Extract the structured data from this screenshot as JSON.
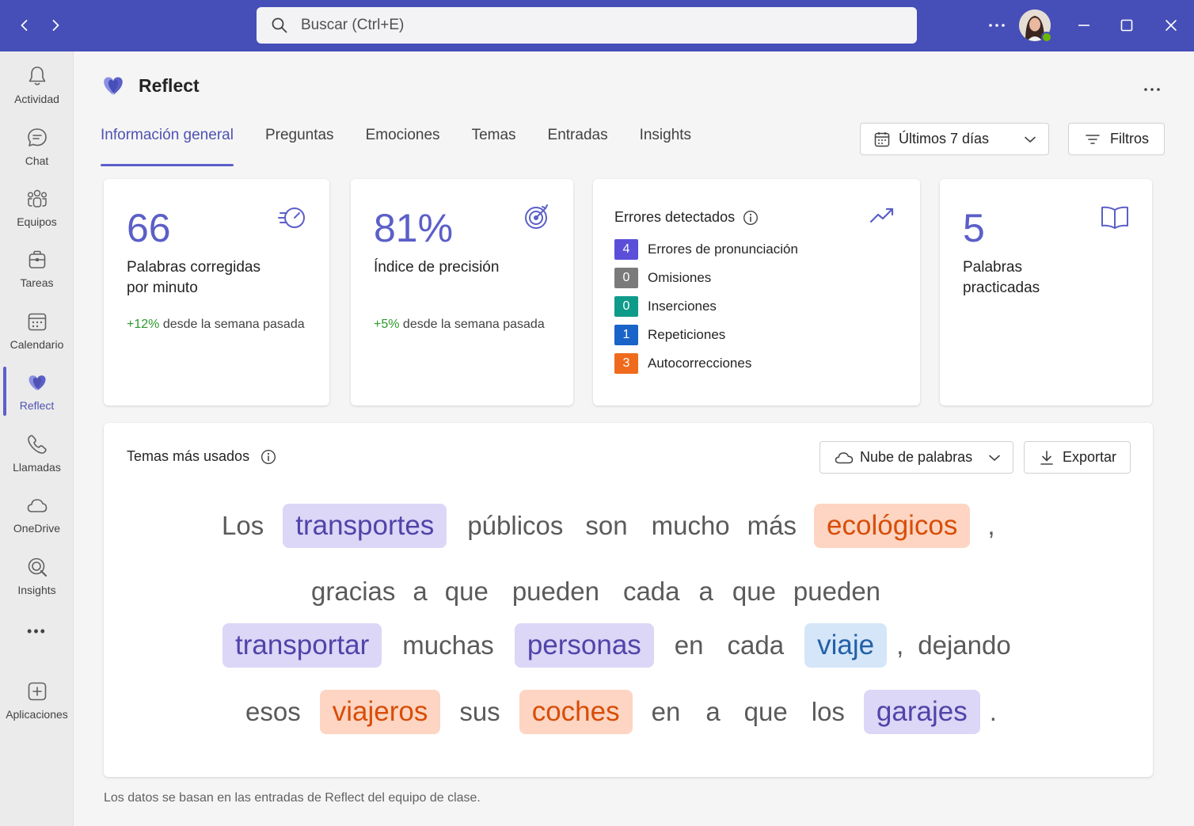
{
  "colors": {
    "titlebar": "#464eb8",
    "accent": "#5b5fc7",
    "positive": "#2c9a2c",
    "chip_purple": "#dcd6f7",
    "chip_orange": "#fdd5c2",
    "chip_blue": "#d4e6f8"
  },
  "titlebar": {
    "search_placeholder": "Buscar (Ctrl+E)",
    "icons": [
      "back-icon",
      "forward-icon",
      "more-icon",
      "avatar",
      "minimize-icon",
      "maximize-icon",
      "close-icon"
    ]
  },
  "rail": {
    "items": [
      {
        "label": "Actividad",
        "icon": "bell-icon"
      },
      {
        "label": "Chat",
        "icon": "chat-icon"
      },
      {
        "label": "Equipos",
        "icon": "teams-icon"
      },
      {
        "label": "Tareas",
        "icon": "tasks-icon"
      },
      {
        "label": "Calendario",
        "icon": "calendar-icon"
      },
      {
        "label": "Reflect",
        "icon": "reflect-icon",
        "active": true
      },
      {
        "label": "Llamadas",
        "icon": "phone-icon"
      },
      {
        "label": "OneDrive",
        "icon": "cloud-icon"
      },
      {
        "label": "Insights",
        "icon": "insights-icon"
      },
      {
        "label": "Aplicaciones",
        "icon": "add-app-icon"
      }
    ],
    "more_label": "•••"
  },
  "app": {
    "title": "Reflect"
  },
  "tabs": [
    {
      "label": "Información general",
      "active": true
    },
    {
      "label": "Preguntas"
    },
    {
      "label": "Emociones"
    },
    {
      "label": "Temas"
    },
    {
      "label": "Entradas"
    },
    {
      "label": "Insights"
    }
  ],
  "toolbar": {
    "date_range": "Últimos 7 días",
    "filters_label": "Filtros"
  },
  "cards": {
    "wcpm": {
      "value": "66",
      "label_line1": "Palabras corregidas",
      "label_line2": "por minuto",
      "delta": "+12%",
      "delta_text": " desde la semana pasada",
      "icon": "speed-icon"
    },
    "accuracy": {
      "value": "81%",
      "label": "Índice de precisión",
      "delta": "+5%",
      "delta_text": " desde la semana pasada",
      "icon": "target-icon"
    },
    "errors": {
      "title": "Errores detectados",
      "icon": "trend-up-icon",
      "rows": [
        {
          "count": "4",
          "label": "Errores de pronunciación",
          "color": "#5b4fd9"
        },
        {
          "count": "0",
          "label": "Omisiones",
          "color": "#7a7a7a"
        },
        {
          "count": "0",
          "label": "Inserciones",
          "color": "#0e9b8a"
        },
        {
          "count": "1",
          "label": "Repeticiones",
          "color": "#1a63c9"
        },
        {
          "count": "3",
          "label": "Autocorrecciones",
          "color": "#f06a1d"
        }
      ]
    },
    "words": {
      "value": "5",
      "label_line1": "Palabras",
      "label_line2": "practicadas",
      "icon": "book-icon"
    }
  },
  "topics": {
    "title": "Temas más usados",
    "view_label": "Nube de palabras",
    "export_label": "Exportar",
    "lines": [
      [
        {
          "t": "Los"
        },
        {
          "t": "transportes",
          "c": "purple"
        },
        {
          "t": "públicos"
        },
        {
          "t": "son"
        },
        {
          "t": "mucho"
        },
        {
          "t": "más"
        },
        {
          "t": "ecológicos",
          "c": "orange"
        },
        {
          "t": ","
        }
      ],
      [
        {
          "t": "gracias"
        },
        {
          "t": "a"
        },
        {
          "t": "que"
        },
        {
          "t": "pueden"
        },
        {
          "t": "cada"
        },
        {
          "t": "a"
        },
        {
          "t": "que"
        },
        {
          "t": "pueden"
        }
      ],
      [
        {
          "t": "transportar",
          "c": "purple"
        },
        {
          "t": "muchas"
        },
        {
          "t": "personas",
          "c": "purple"
        },
        {
          "t": "en"
        },
        {
          "t": "cada"
        },
        {
          "t": "viaje",
          "c": "blue"
        },
        {
          "t": ","
        },
        {
          "t": "dejando"
        }
      ],
      [
        {
          "t": "esos"
        },
        {
          "t": "viajeros",
          "c": "orange"
        },
        {
          "t": "sus"
        },
        {
          "t": "coches",
          "c": "orange"
        },
        {
          "t": "en"
        },
        {
          "t": "a"
        },
        {
          "t": "que"
        },
        {
          "t": "los"
        },
        {
          "t": "garajes",
          "c": "purple"
        },
        {
          "t": "."
        }
      ]
    ]
  },
  "footnote": "Los datos se basan en las entradas de Reflect del equipo de clase."
}
